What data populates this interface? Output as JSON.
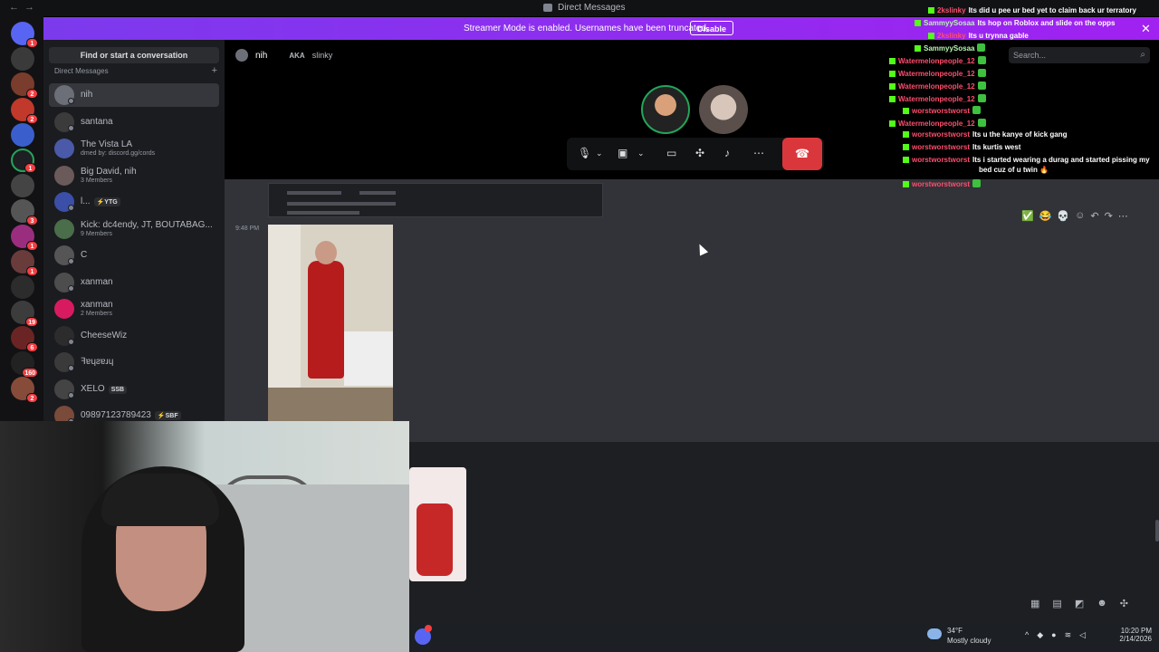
{
  "titlebar": {
    "title": "Direct Messages"
  },
  "banner": {
    "message": "Streamer Mode is enabled. Usernames have been truncated.",
    "button": "Disable"
  },
  "sidebar": {
    "find_button": "Find or start a conversation",
    "dm_header": "Direct Messages",
    "items": [
      {
        "name": "nih",
        "sub": "",
        "tag": ""
      },
      {
        "name": "santana",
        "sub": "",
        "tag": ""
      },
      {
        "name": "The Vista LA",
        "sub": "dmed by: discord.gg/cords",
        "tag": ""
      },
      {
        "name": "Big David, nih",
        "sub": "3 Members",
        "tag": ""
      },
      {
        "name": "l...",
        "sub": "",
        "tag": "⚡YTG"
      },
      {
        "name": "Kick: dc4endy, JT, BOUTABAG...",
        "sub": "9 Members",
        "tag": ""
      },
      {
        "name": "C",
        "sub": "",
        "tag": ""
      },
      {
        "name": "xanman",
        "sub": "",
        "tag": ""
      },
      {
        "name": "xanman",
        "sub": "2 Members",
        "tag": ""
      },
      {
        "name": "CheeseWiz",
        "sub": "",
        "tag": ""
      },
      {
        "name": "ꟻɐɥƨɐɹɥ",
        "sub": "",
        "tag": ""
      },
      {
        "name": "XELO",
        "sub": "",
        "tag": "SSB"
      },
      {
        "name": "09897123789423",
        "sub": "",
        "tag": "⚡SBF"
      }
    ]
  },
  "server_badges": [
    "1",
    "",
    "2",
    "2",
    "",
    "1",
    "",
    "3",
    "1",
    "1",
    "",
    "19",
    "6",
    "160",
    "2"
  ],
  "channel": {
    "name": "nih",
    "aka": "AKA",
    "alias": "slinky",
    "search_placeholder": "Search..."
  },
  "call": {
    "controls": [
      "mic-icon",
      "chevron-down-icon",
      "camera-off-icon",
      "chevron-down-icon",
      "screen-share-icon",
      "activities-icon",
      "soundboard-icon",
      "more-icon"
    ]
  },
  "chat": {
    "timestamp": "9:48 PM"
  },
  "stream_chat": [
    {
      "user": "2kslinky",
      "color": "#ff4d6d",
      "msg": "Its did u pee ur bed yet to claim back ur terratory"
    },
    {
      "user": "SammyySosaa",
      "color": "#b8f5b0",
      "msg": "Its hop on Roblox and slide on the opps"
    },
    {
      "user": "2kslinky",
      "color": "#ff4d6d",
      "msg": "Its u trynna gable"
    },
    {
      "user": "SammyySosaa",
      "color": "#b8f5b0",
      "msg": ""
    },
    {
      "user": "Watermelonpeople_12",
      "color": "#ff4d6d",
      "msg": ""
    },
    {
      "user": "Watermelonpeople_12",
      "color": "#ff4d6d",
      "msg": ""
    },
    {
      "user": "Watermelonpeople_12",
      "color": "#ff4d6d",
      "msg": ""
    },
    {
      "user": "Watermelonpeople_12",
      "color": "#ff4d6d",
      "msg": ""
    },
    {
      "user": "worstworstworst",
      "color": "#ff4d6d",
      "msg": ""
    },
    {
      "user": "Watermelonpeople_12",
      "color": "#ff4d6d",
      "msg": ""
    },
    {
      "user": "worstworstworst",
      "color": "#ff4d6d",
      "msg": "Its u the kanye of kick gang"
    },
    {
      "user": "worstworstworst",
      "color": "#ff4d6d",
      "msg": "Its kurtis west"
    },
    {
      "user": "worstworstworst",
      "color": "#ff4d6d",
      "msg": "Its i started wearing a durag and started pissing my"
    },
    {
      "user": "",
      "color": "#ff4d6d",
      "msg": "bed cuz of u twin 🔥"
    },
    {
      "user": "worstworstworst",
      "color": "#ff4d6d",
      "msg": ""
    }
  ],
  "taskbar": {
    "temp": "34°F",
    "condition": "Mostly cloudy",
    "time": "10:20 PM",
    "date": "2/14/2026"
  },
  "colors": {
    "blurple": "#5865f2",
    "banner": "#a021f0",
    "end_call": "#da373c",
    "kick_green": "#53fc18"
  }
}
